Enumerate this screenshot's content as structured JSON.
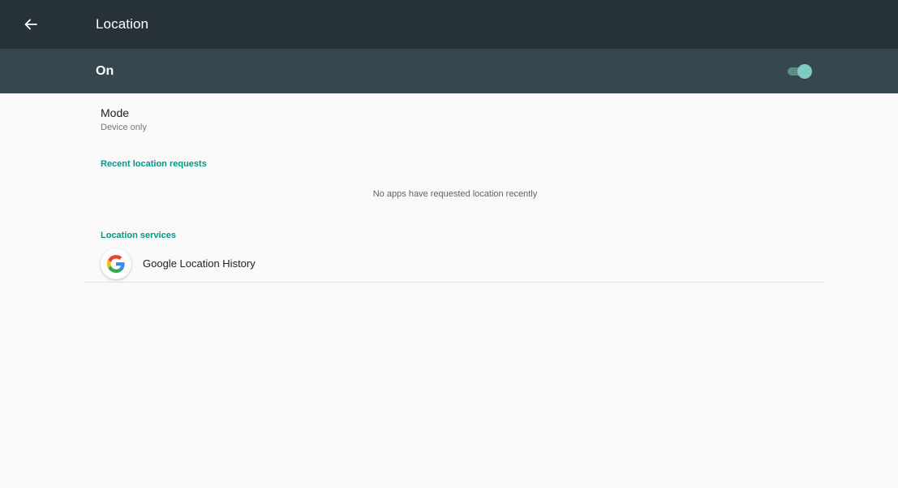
{
  "toolbar": {
    "title": "Location",
    "back_icon": "arrow-left-icon"
  },
  "master_switch": {
    "label": "On",
    "state": "on",
    "track_color": "#5e8c87",
    "thumb_color": "#80cbc4"
  },
  "mode": {
    "title": "Mode",
    "summary": "Device only"
  },
  "recent_requests": {
    "header": "Recent location requests",
    "empty_text": "No apps have requested location recently"
  },
  "location_services": {
    "header": "Location services",
    "items": [
      {
        "label": "Google Location History",
        "icon": "google-g-icon"
      }
    ]
  },
  "colors": {
    "toolbar_bg": "#263238",
    "switch_bar_bg": "#37474f",
    "accent": "#009688",
    "background": "#fafafa"
  }
}
